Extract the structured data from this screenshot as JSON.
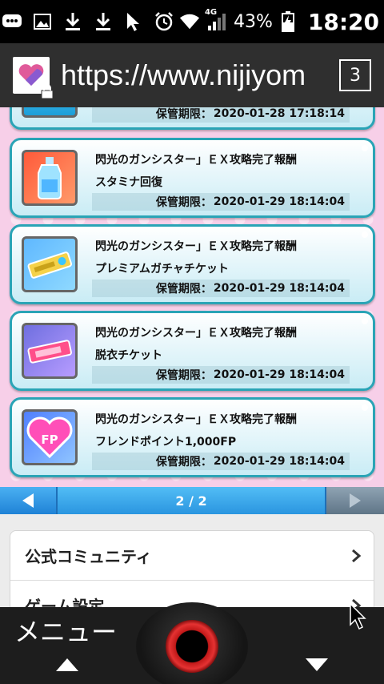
{
  "status_bar": {
    "network": "4G",
    "battery": "43%",
    "time": "18:20"
  },
  "browser": {
    "url": "https://www.nijiyom",
    "tab_count": "3"
  },
  "cards": [
    {
      "title": "",
      "name": "",
      "expiry_label": "保管期限：",
      "expiry_value": "2020-01-28 17:18:14",
      "icon": "partial-item-icon"
    },
    {
      "title": "閃光のガンシスター」ＥＸ攻略完了報酬",
      "name": "スタミナ回復",
      "expiry_label": "保管期限：",
      "expiry_value": "2020-01-29 18:14:04",
      "icon": "stamina-bottle-icon"
    },
    {
      "title": "閃光のガンシスター」ＥＸ攻略完了報酬",
      "name": "プレミアムガチャチケット",
      "expiry_label": "保管期限：",
      "expiry_value": "2020-01-29 18:14:04",
      "icon": "gacha-ticket-icon"
    },
    {
      "title": "閃光のガンシスター」ＥＸ攻略完了報酬",
      "name": "脱衣チケット",
      "expiry_label": "保管期限：",
      "expiry_value": "2020-01-29 18:14:04",
      "icon": "undress-ticket-icon"
    },
    {
      "title": "閃光のガンシスター」ＥＸ攻略完了報酬",
      "name": "フレンドポイント1,000FP",
      "expiry_label": "保管期限：",
      "expiry_value": "2020-01-29 18:14:04",
      "icon": "friend-point-icon"
    }
  ],
  "pager": {
    "label": "2 / 2"
  },
  "menu": {
    "items": [
      {
        "label": "公式コミュニティ"
      },
      {
        "label": "ゲーム設定"
      }
    ]
  },
  "bottom_nav": {
    "menu_label": "メニュー"
  },
  "colors": {
    "card_border": "#2aa4b6",
    "pager_blue": "#2a95e0",
    "page_pink": "#f7cfe8"
  }
}
